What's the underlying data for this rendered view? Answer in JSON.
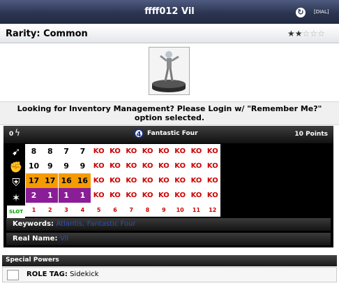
{
  "header": {
    "title": "ffff012 Vil",
    "dial_label": "[DIAL]",
    "refresh_icon": "refresh-icon"
  },
  "rarity": {
    "label": "Rarity: Common",
    "stars_filled": 2,
    "stars_total": 5
  },
  "figure": {
    "icon": "figure-image"
  },
  "login_message": "Looking for Inventory Management? Please Login w/ \"Remember Me?\" option selected.",
  "panel": {
    "point_cost_left": "0",
    "team_number": "4",
    "team_name": "Fantastic Four",
    "points": "10 Points"
  },
  "stats": {
    "icons": [
      "speed-icon",
      "attack-icon",
      "defense-icon",
      "damage-icon"
    ],
    "slot_label": "SLOT",
    "rows": [
      [
        "8",
        "8",
        "7",
        "7",
        "KO",
        "KO",
        "KO",
        "KO",
        "KO",
        "KO",
        "KO",
        "KO"
      ],
      [
        "10",
        "9",
        "9",
        "9",
        "KO",
        "KO",
        "KO",
        "KO",
        "KO",
        "KO",
        "KO",
        "KO"
      ],
      [
        "17",
        "17",
        "16",
        "16",
        "KO",
        "KO",
        "KO",
        "KO",
        "KO",
        "KO",
        "KO",
        "KO"
      ],
      [
        "2",
        "1",
        "1",
        "1",
        "KO",
        "KO",
        "KO",
        "KO",
        "KO",
        "KO",
        "KO",
        "KO"
      ]
    ],
    "slots": [
      "1",
      "2",
      "3",
      "4",
      "5",
      "6",
      "7",
      "8",
      "9",
      "10",
      "11",
      "12"
    ]
  },
  "keywords": {
    "label": "Keywords:",
    "items": [
      "Atlantis",
      "Fantastic Four"
    ],
    "separator": ", "
  },
  "real_name": {
    "label": "Real Name:",
    "value": "Vil"
  },
  "special_powers": {
    "heading": "Special Powers",
    "role_tag_label": "ROLE TAG:",
    "role_tag_value": "Sidekick"
  }
}
